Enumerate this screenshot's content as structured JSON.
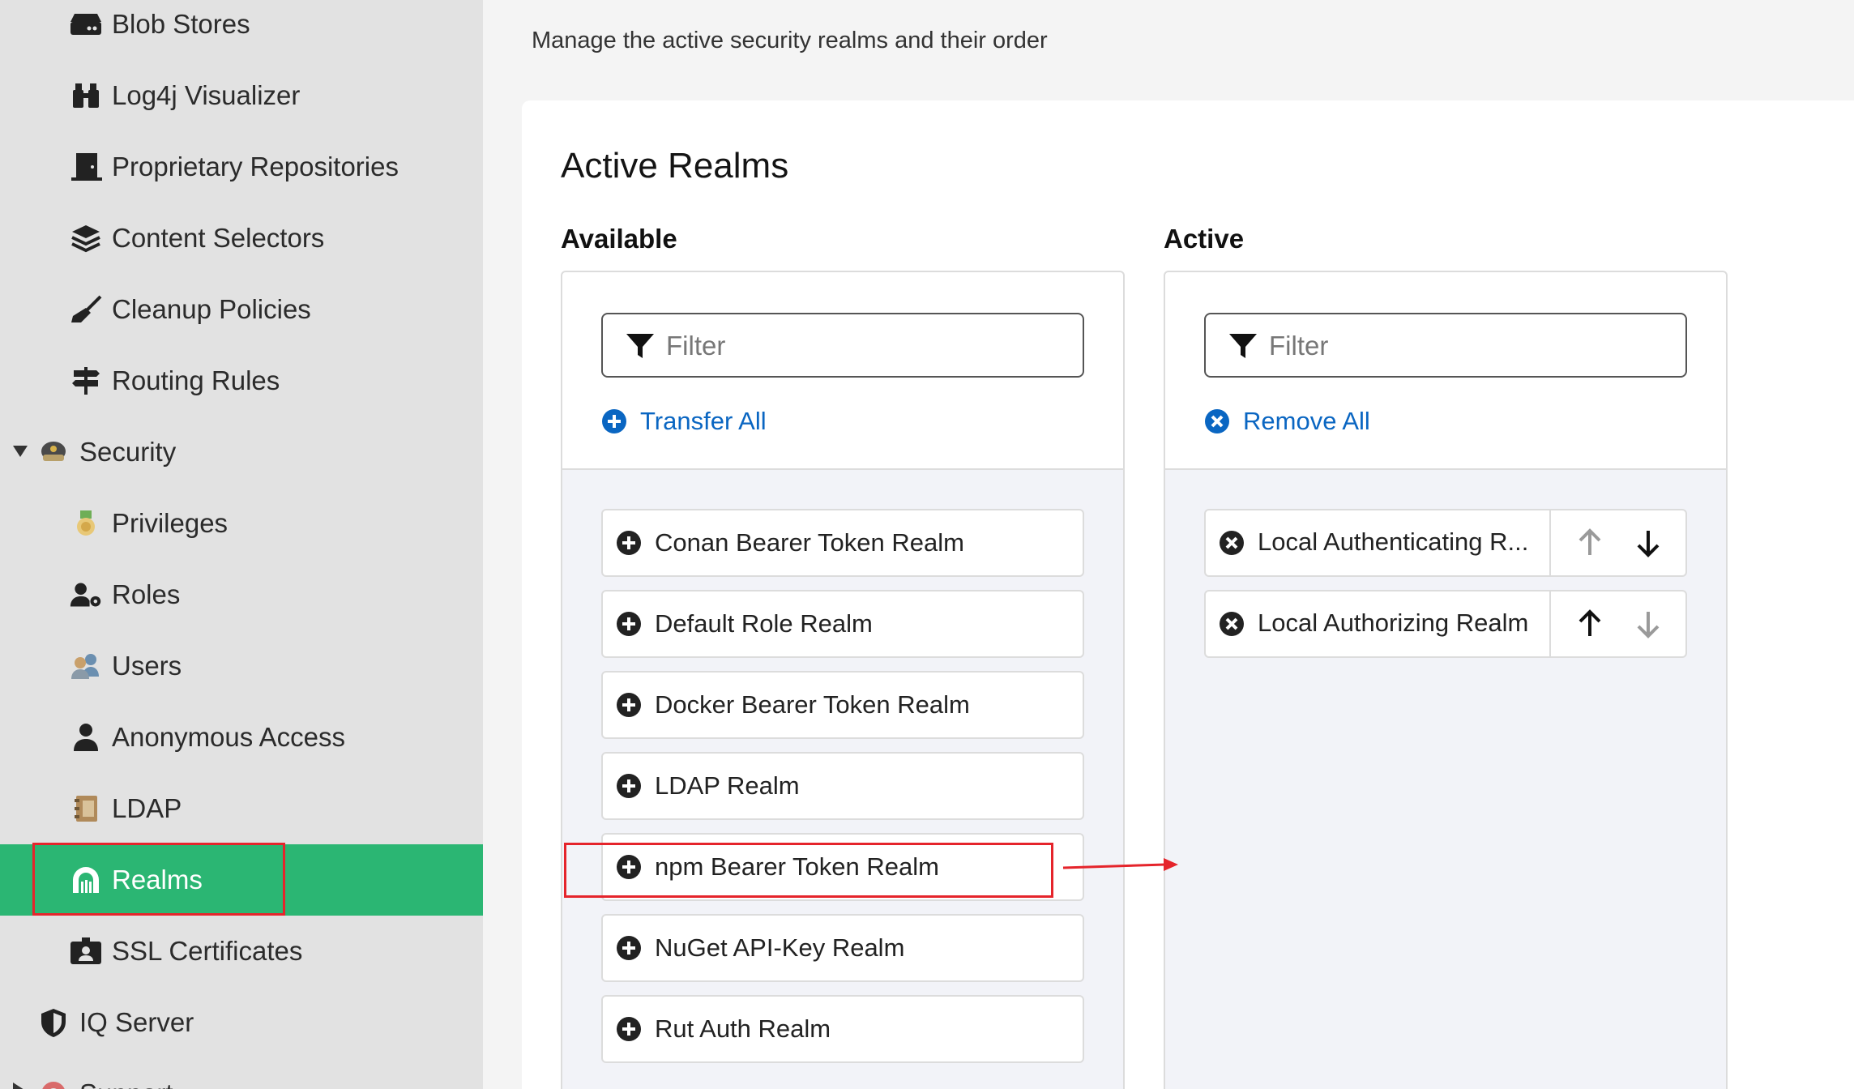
{
  "sidebar": {
    "items": [
      {
        "label": "Blob Stores",
        "icon": "hdd-icon"
      },
      {
        "label": "Log4j Visualizer",
        "icon": "binoculars-icon"
      },
      {
        "label": "Proprietary Repositories",
        "icon": "door-icon"
      },
      {
        "label": "Content Selectors",
        "icon": "layers-icon"
      },
      {
        "label": "Cleanup Policies",
        "icon": "broom-icon"
      },
      {
        "label": "Routing Rules",
        "icon": "signpost-icon"
      },
      {
        "label": "Security",
        "icon": "police-badge-icon"
      },
      {
        "label": "Privileges",
        "icon": "medal-icon"
      },
      {
        "label": "Roles",
        "icon": "user-cog-icon"
      },
      {
        "label": "Users",
        "icon": "users-icon"
      },
      {
        "label": "Anonymous Access",
        "icon": "user-icon"
      },
      {
        "label": "LDAP",
        "icon": "address-book-icon"
      },
      {
        "label": "Realms",
        "icon": "dungeon-icon"
      },
      {
        "label": "SSL Certificates",
        "icon": "id-badge-icon"
      },
      {
        "label": "IQ Server",
        "icon": "shield-icon"
      },
      {
        "label": "Support",
        "icon": "lifebuoy-icon"
      }
    ]
  },
  "page": {
    "subtitle": "Manage the active security realms and their order",
    "title": "Active Realms"
  },
  "available": {
    "title": "Available",
    "filter_placeholder": "Filter",
    "action_label": "Transfer All",
    "items": [
      "Conan Bearer Token Realm",
      "Default Role Realm",
      "Docker Bearer Token Realm",
      "LDAP Realm",
      "npm Bearer Token Realm",
      "NuGet API-Key Realm",
      "Rut Auth Realm"
    ]
  },
  "active": {
    "title": "Active",
    "filter_placeholder": "Filter",
    "action_label": "Remove All",
    "items": [
      "Local Authenticating R...",
      "Local Authorizing Realm"
    ]
  },
  "colors": {
    "sidebar_bg": "#e2e2e2",
    "active_nav": "#2bb673",
    "link_blue": "#0a66c2",
    "annotation_red": "#e5242b"
  }
}
